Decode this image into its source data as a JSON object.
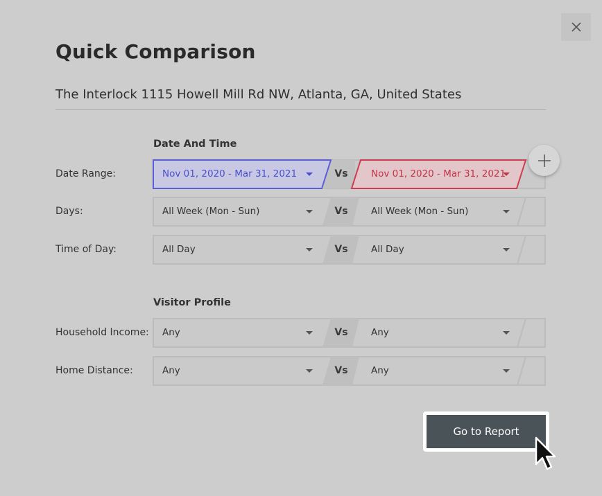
{
  "dialog": {
    "title": "Quick Comparison",
    "location": "The Interlock 1115 Howell Mill Rd NW, Atlanta, GA, United States",
    "close_icon": "close-icon",
    "add_icon": "plus-icon"
  },
  "sections": {
    "date_time": "Date And Time",
    "visitor_profile": "Visitor Profile"
  },
  "vs_label": "Vs",
  "rows": {
    "date_range": {
      "label": "Date Range:",
      "left": "Nov 01, 2020 - Mar 31, 2021",
      "right": "Nov 01, 2020 - Mar 31, 2021"
    },
    "days": {
      "label": "Days:",
      "left": "All Week (Mon - Sun)",
      "right": "All Week (Mon - Sun)"
    },
    "time_of_day": {
      "label": "Time of Day:",
      "left": "All Day",
      "right": "All Day"
    },
    "household_income": {
      "label": "Household Income:",
      "left": "Any",
      "right": "Any"
    },
    "home_distance": {
      "label": "Home Distance:",
      "left": "Any",
      "right": "Any"
    }
  },
  "actions": {
    "go_to_report": "Go to Report"
  },
  "colors": {
    "primary_compare": "#5b5fd6",
    "secondary_compare": "#cc3d50",
    "button_bg": "#4a5358"
  }
}
